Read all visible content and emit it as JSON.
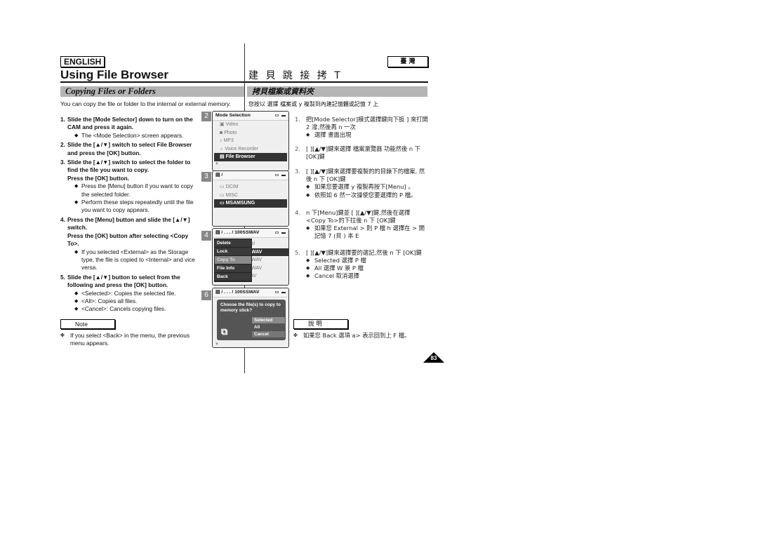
{
  "left": {
    "language": "ENGLISH",
    "title": "Using File Browser",
    "section": "Copying Files or Folders",
    "intro": "You can copy the file or folder to the internal or external memory.",
    "steps": [
      {
        "num": "1.",
        "text": "Slide the [Mode Selector] down to turn on the CAM and press it again.",
        "bullets": [
          "The <Mode Selection> screen appears."
        ]
      },
      {
        "num": "2.",
        "text": "Slide the [▲/▼] switch to select File Browser and press the [OK] button.",
        "bullets": []
      },
      {
        "num": "3.",
        "text": "Slide the [▲/▼] switch to select the folder to find the file you want to copy.",
        "text2": "Press the [OK] button.",
        "bullets": [
          "Press the [Menu] button if you want to copy the selected folder.",
          "Perform these steps repeatedly until the file you want to copy appears."
        ]
      },
      {
        "num": "4.",
        "text": "Press the [Menu] button and slide the [▲/▼] switch.",
        "text2": "Press the [OK] button after selecting <Copy To>.",
        "bullets": [
          "If you selected <External> as the Storage type, the file is copied to <Internal> and vice versa."
        ]
      },
      {
        "num": "5.",
        "text": "Slide the [▲/▼] button to select from the following and press the [OK] button.",
        "bullets": [
          "<Selected>: Copies the selected file.",
          "<All>: Copies all files.",
          "<Cancel>: Cancels copying files."
        ]
      }
    ],
    "note_label": "Note",
    "note_text": "If you select <Back> in the menu, the previous menu appears."
  },
  "screens": {
    "s2": {
      "step": "2",
      "header": "Mode Selection",
      "status": "▭ ▬",
      "items": [
        "Video",
        "Photo",
        "MP3",
        "Voice Recorder",
        "File Browser"
      ],
      "icons": [
        "video-icon",
        "photo-icon",
        "mp3-icon",
        "voice-recorder-icon",
        "file-browser-icon"
      ],
      "glyphs": [
        "🎞",
        "📷",
        "♪",
        "🎙",
        "▤"
      ],
      "selected": 4
    },
    "s3": {
      "step": "3",
      "header": "/",
      "status": "▭ ▬",
      "items": [
        "DCIM",
        "MISC",
        "MSAMSUNG"
      ],
      "selected": 2
    },
    "s4": {
      "step": "4",
      "header": "/ . . . / 100SSWAV",
      "status": "▭ ▬",
      "menu": [
        "Delete",
        "Lock",
        "Copy To",
        "File Info",
        "Back"
      ],
      "highlight": 2,
      "behind": [
        "sl",
        "WAV",
        "WAV",
        "WAV",
        "SWAV0004.WAV"
      ]
    },
    "s6": {
      "step": "6",
      "header": "/ . . . / 100SSWAV",
      "status": "▭ ▬",
      "question": "Choose the file(s) to copy to memory stick?",
      "options": [
        "Selected",
        "All",
        "Cancel"
      ],
      "selected": 0
    }
  },
  "right": {
    "language": "臺 灣",
    "title": "建 貝 跳 接 拷 T",
    "section": "拷貝檔案或資料夾",
    "intro": "您按以 選擇 檔案或 y 複製到內建記憶體或記憶 7 上",
    "steps": [
      {
        "num": "1.",
        "text": "把[Mode Selector]模式選擇鍵向下扳 ] 來打開2 潑,然後再 n 一次",
        "bullets": [
          "選擇 畫面出現"
        ]
      },
      {
        "num": "2.",
        "text": "[ ][▲/▼]鍵來選擇 檔案瀏覽器 功能然後 n 下 [OK]鍵",
        "bullets": []
      },
      {
        "num": "3.",
        "text": "[ ][▲/▼]鍵來選擇要複製的的目錄下的檔案, 然後 n 下 [OK]鍵",
        "bullets": [
          "如果您要選擇 y 複製再按下[Menu] 。",
          "依照如 6 然一次操使您要選擇的 P 檔。"
        ]
      },
      {
        "num": "4.",
        "text": "n 下[Menu]鍵並 [ ][▲/▼]鍵,然後在選擇 <Copy To>的下拉後 n 下 [OK]鍵",
        "bullets": [
          "如果您 External > 則 P 檔 h 選擇在 > 開 記憶 7 (貝 ) 本 E"
        ]
      },
      {
        "num": "5.",
        "text": "[ ][▲/▼]鍵來選擇要的選記,然後 n 下 [OK]鍵",
        "bullets": [
          "Selected 選擇 P 檔",
          "All 選擇 W 景 P 檔",
          "Cancel 取消選擇"
        ]
      }
    ],
    "note_label": "說 明",
    "note_text": "如果您 Back 選項 a> 表示回到上 F 檔。"
  },
  "page_number": "83"
}
